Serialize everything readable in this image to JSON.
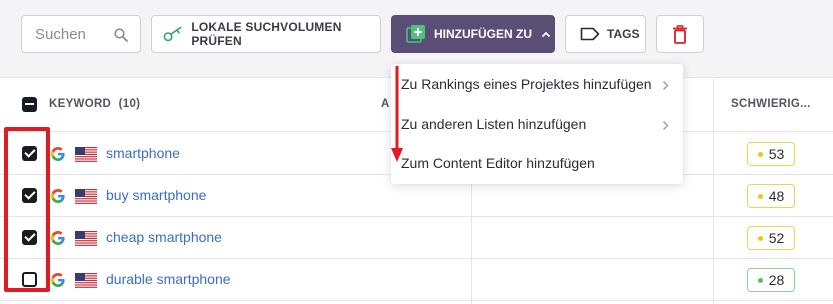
{
  "toolbar": {
    "search_placeholder": "Suchen",
    "search_icon": "search-icon",
    "check_volume_label": "LOKALE SUCHVOLUMEN PRÜFEN",
    "check_volume_icon": "key-icon",
    "add_to_label": "HINZUFÜGEN ZU",
    "add_to_icon": "plus-square-icon",
    "tags_label": "TAGS",
    "tags_icon": "tag-icon",
    "delete_icon": "trash-icon",
    "accent_color": "#5a4e76",
    "delete_color": "#e01b24"
  },
  "table": {
    "header": {
      "keyword_label": "KEYWORD",
      "keyword_count": "(10)",
      "hidden_col_fragment": "A",
      "difficulty_label": "SCHWIERIG..."
    },
    "rows": [
      {
        "keyword": "smartphone",
        "checked": true,
        "difficulty": "53",
        "difficulty_level": "yellow"
      },
      {
        "keyword": "buy smartphone",
        "checked": true,
        "difficulty": "48",
        "difficulty_level": "yellow"
      },
      {
        "keyword": "cheap smartphone",
        "checked": true,
        "difficulty": "52",
        "difficulty_level": "yellow"
      },
      {
        "keyword": "durable smartphone",
        "checked": false,
        "difficulty": "28",
        "difficulty_level": "green"
      }
    ],
    "search_engine_icon": "google-icon",
    "country_icon": "us-flag-icon"
  },
  "dropdown": {
    "items": [
      {
        "label": "Zu Rankings eines Projektes hinzufügen",
        "has_submenu": true
      },
      {
        "label": "Zu anderen Listen hinzufügen",
        "has_submenu": true
      },
      {
        "label": "Zum Content Editor hinzufügen",
        "has_submenu": false
      }
    ]
  },
  "annotations": {
    "highlight_color": "#e01b24"
  }
}
